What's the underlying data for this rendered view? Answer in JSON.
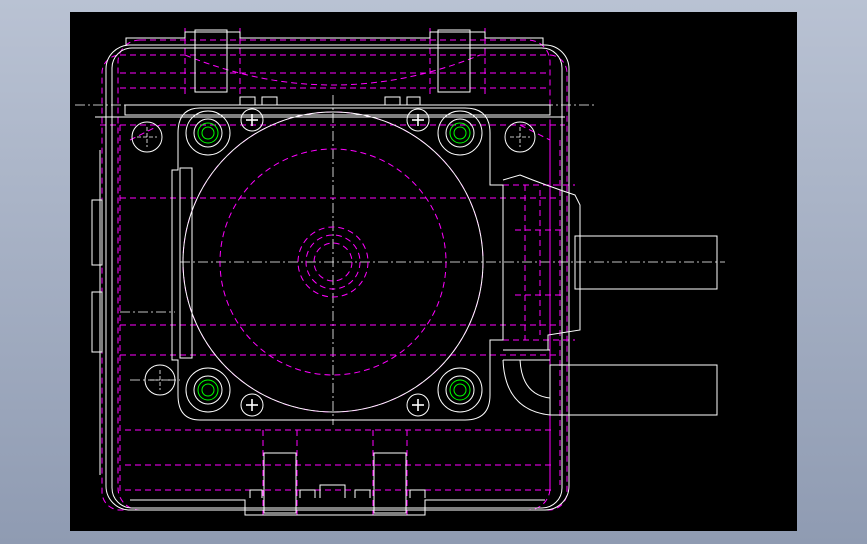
{
  "drawing": {
    "background_color": "#000000",
    "frame_background": "#9aa5ba",
    "colors": {
      "outline": "#ffffff",
      "hidden_line": "#ff00ff",
      "bolt": "#00ff00",
      "centerline": "#ffffff"
    },
    "views": [
      "top-view"
    ],
    "has_text": false
  }
}
